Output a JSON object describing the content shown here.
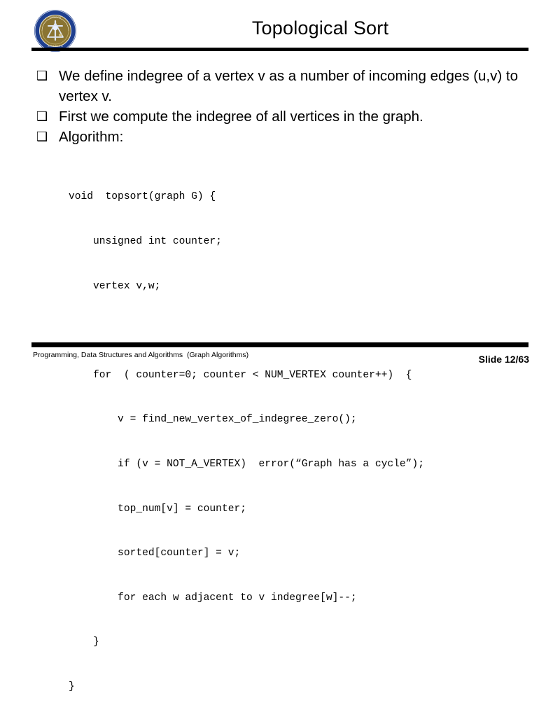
{
  "slide": {
    "title": "Topological Sort",
    "logo": {
      "name": "institution-seal-logo",
      "ring_color": "#1f3f8f",
      "field_color": "#8a7432",
      "text_color": "#e8e2c8",
      "emblem_color": "#dfe6f2"
    },
    "bullets": [
      {
        "marker": "❑",
        "text": "We define indegree of a vertex v as a number of incoming edges (u,v) to vertex v."
      },
      {
        "marker": "❑",
        "text": "First we compute the indegree of all vertices in the graph."
      },
      {
        "marker": "❑",
        "text": "Algorithm:"
      }
    ],
    "code": [
      "void  topsort(graph G) {",
      "    unsigned int counter;",
      "    vertex v,w;",
      "",
      "    for  ( counter=0; counter < NUM_VERTEX counter++)  {",
      "        v = find_new_vertex_of_indegree_zero();",
      "        if (v = NOT_A_VERTEX)  error(“Graph has a cycle”);",
      "        top_num[v] = counter;",
      "        sorted[counter] = v;",
      "        for each w adjacent to v indegree[w]--;",
      "    }",
      "}"
    ],
    "footer": {
      "course": "Programming, Data Structures and Algorithms  (Graph Algorithms)",
      "slide_number": "Slide 12/63"
    }
  }
}
